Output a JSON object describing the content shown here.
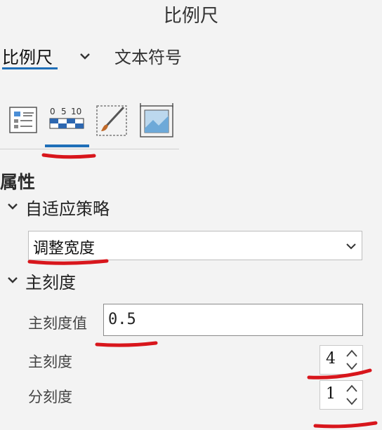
{
  "header": {
    "title": "比例尺"
  },
  "tabs": {
    "active_label": "比例尺",
    "other_label": "文本符号"
  },
  "icons": [
    "layout-list-icon",
    "scale-bar-icon",
    "brush-icon",
    "frame-image-icon"
  ],
  "sections": {
    "properties": "属性",
    "fitting_strategy": {
      "label": "自适应策略",
      "value": "调整宽度"
    },
    "major_division": {
      "label": "主刻度",
      "value_label": "主刻度值",
      "value": "0.5",
      "divisions_label": "主刻度",
      "divisions_value": "4",
      "subdivisions_label": "分刻度",
      "subdivisions_value": "1"
    }
  },
  "colors": {
    "accent": "#1f6fb8",
    "annotation": "#d8161c",
    "background": "#f3f3f3"
  }
}
